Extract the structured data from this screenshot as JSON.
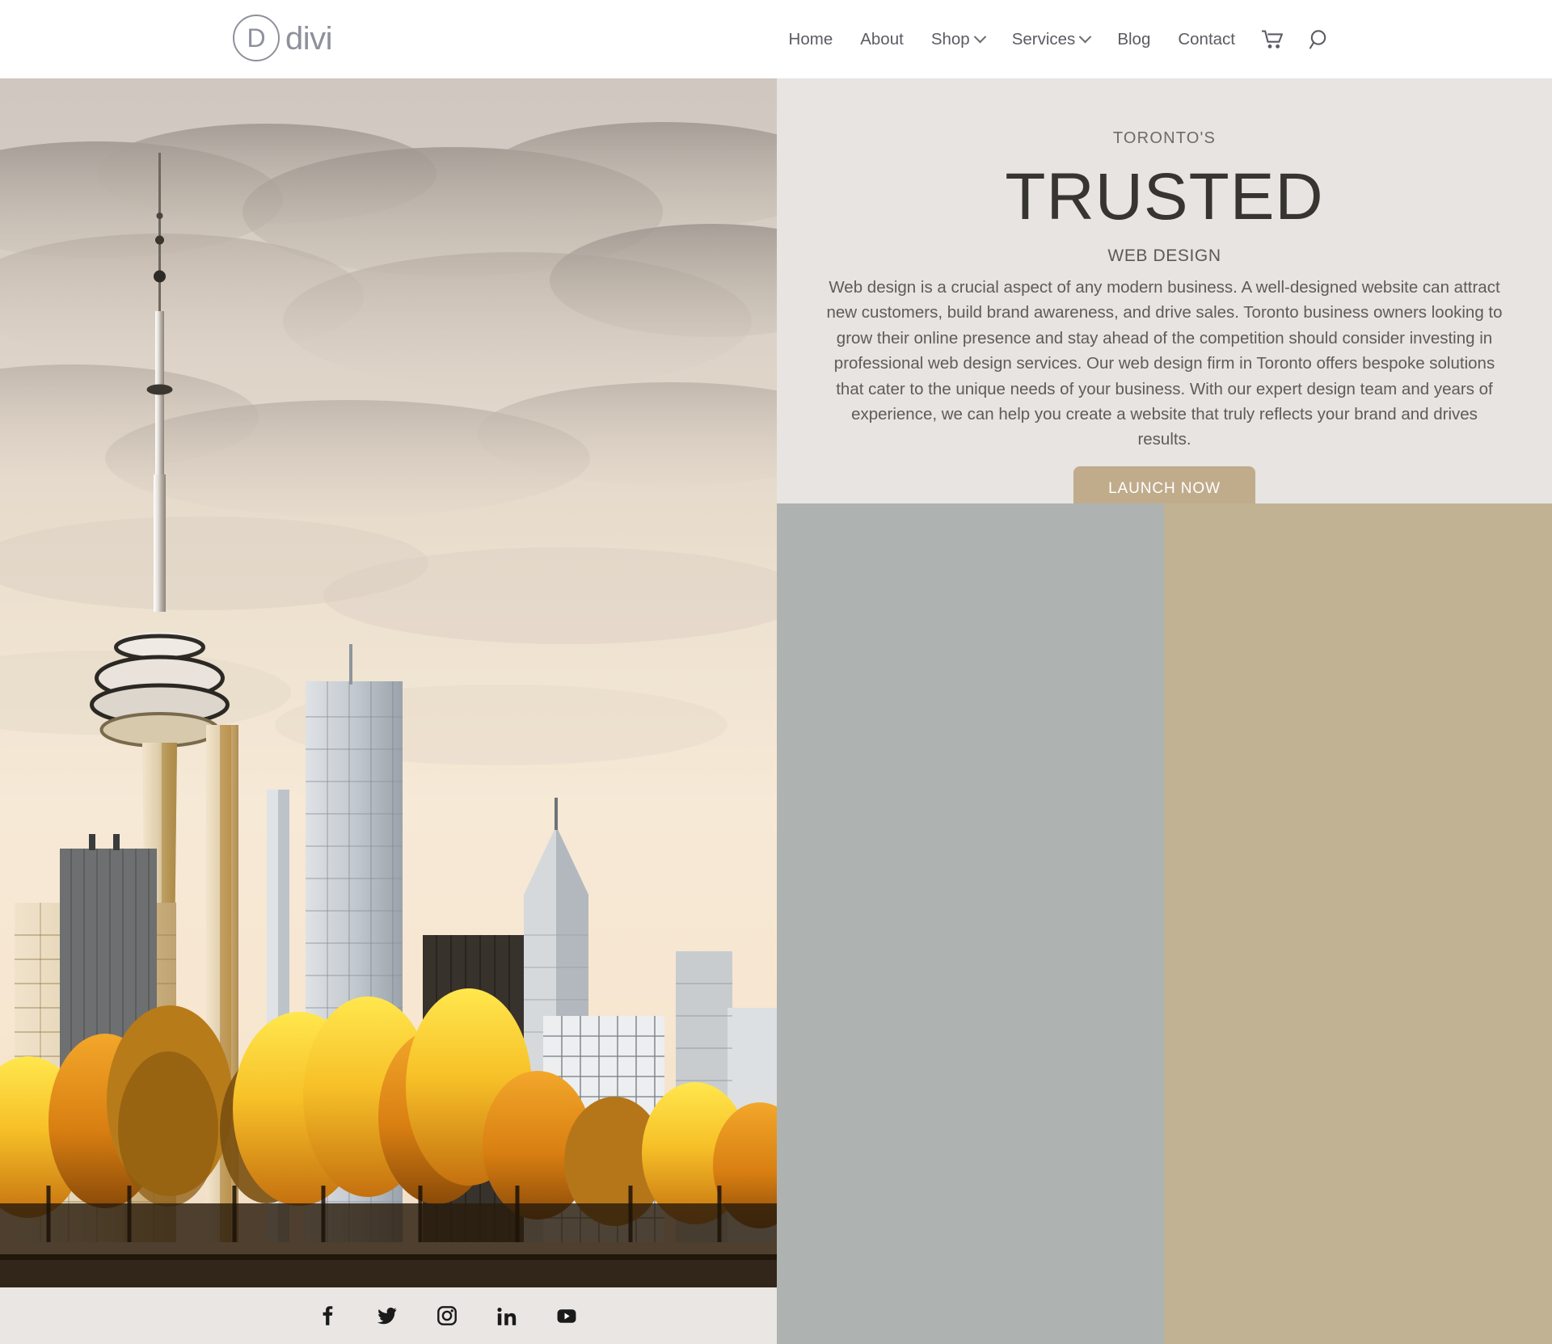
{
  "header": {
    "logo": {
      "mark": "D",
      "text": "divi"
    },
    "nav": [
      {
        "label": "Home",
        "has_dropdown": false
      },
      {
        "label": "About",
        "has_dropdown": false
      },
      {
        "label": "Shop",
        "has_dropdown": true
      },
      {
        "label": "Services",
        "has_dropdown": true
      },
      {
        "label": "Blog",
        "has_dropdown": false
      },
      {
        "label": "Contact",
        "has_dropdown": false
      }
    ],
    "icons": [
      {
        "name": "cart-icon"
      },
      {
        "name": "search-icon"
      }
    ]
  },
  "hero": {
    "eyebrow": "TORONTO'S",
    "headline": "TRUSTED",
    "subhead": "WEB DESIGN",
    "body": "Web design is a crucial aspect of any modern business. A well-designed website can attract new customers, build brand awareness, and drive sales. Toronto business owners looking to grow their online presence and stay ahead of the competition should consider investing in professional web design services. Our web design firm in Toronto offers bespoke solutions that cater to the unique needs of your business. With our expert design team and years of experience, we can help you create a website that truly reflects your brand and drives results.",
    "cta_label": "LAUNCH NOW",
    "image_alt": "Toronto skyline with CN Tower and autumn trees at sunset"
  },
  "blocks": {
    "gray_color": "#aeb3b2",
    "tan_color": "#c2b294"
  },
  "footer": {
    "social": [
      {
        "name": "facebook-icon",
        "label": "Facebook"
      },
      {
        "name": "twitter-icon",
        "label": "Twitter"
      },
      {
        "name": "instagram-icon",
        "label": "Instagram"
      },
      {
        "name": "linkedin-icon",
        "label": "LinkedIn"
      },
      {
        "name": "youtube-icon",
        "label": "YouTube"
      }
    ]
  },
  "colors": {
    "hero_bg": "#e7e4e1",
    "cta_bg": "#c0ab8b",
    "nav_text": "#5b5b63",
    "logo": "#8e919c",
    "headline": "#37352f"
  }
}
